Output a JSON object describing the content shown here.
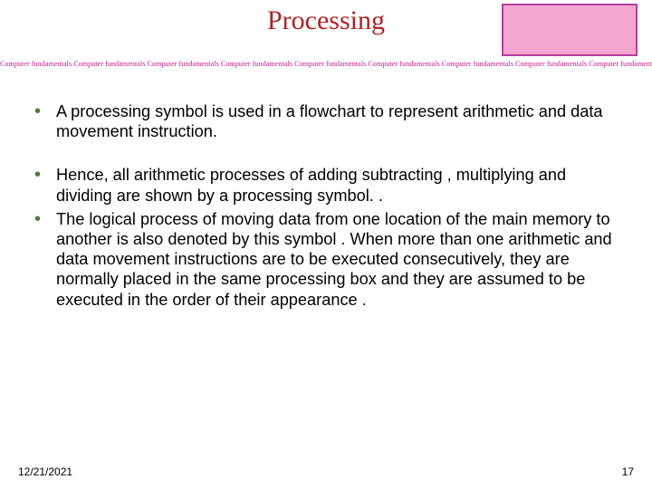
{
  "title": "Processing",
  "ribbon_phrase": "Computer fundamentals ",
  "bullets": [
    "A processing symbol is used in a flowchart to represent arithmetic and data movement instruction.",
    " Hence, all arithmetic processes of adding subtracting , multiplying and dividing are shown by a processing symbol. .",
    "The logical process of moving data from one location of the main memory to another is also denoted by this symbol . When more than one arithmetic and data movement instructions are to be executed consecutively, they are normally placed in the same processing box and they are assumed to be executed in the order of their appearance ."
  ],
  "footer": {
    "date": "12/21/2021",
    "page": "17"
  }
}
